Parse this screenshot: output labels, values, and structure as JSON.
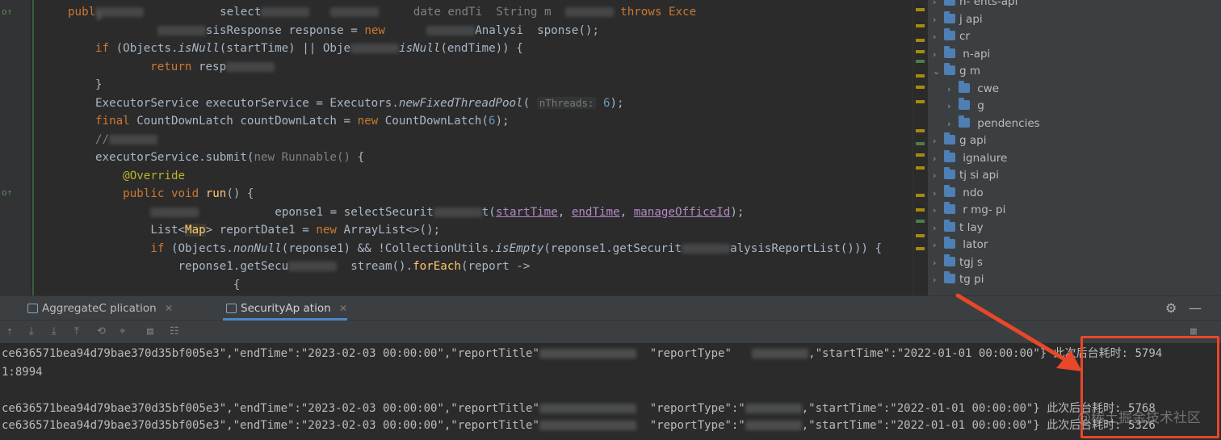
{
  "editor": {
    "lines": [
      {
        "segments": [
          {
            "t": "publ",
            "c": "kw"
          },
          {
            "t": "i",
            "c": "blur"
          },
          {
            "t": "           select",
            "c": ""
          },
          {
            "t": "",
            "c": "blur"
          },
          {
            "t": "   ",
            "c": ""
          },
          {
            "t": "",
            "c": "blur"
          },
          {
            "t": "     date endTi  String m  ",
            "c": "gray"
          },
          {
            "t": "",
            "c": "blur"
          },
          {
            "t": " throws Exce",
            "c": "kw"
          }
        ]
      },
      {
        "segments": [
          {
            "t": "         ",
            "c": ""
          },
          {
            "t": "",
            "c": "blur"
          },
          {
            "t": "sisResponse response = ",
            "c": ""
          },
          {
            "t": "new",
            "c": "kw"
          },
          {
            "t": "      ",
            "c": ""
          },
          {
            "t": "",
            "c": "blur"
          },
          {
            "t": "Analysi  sponse();",
            "c": ""
          }
        ]
      },
      {
        "segments": [
          {
            "t": "if",
            "c": "kw"
          },
          {
            "t": " (Objects.",
            "c": ""
          },
          {
            "t": "isNull",
            "c": "it"
          },
          {
            "t": "(startTime) || Obje",
            "c": ""
          },
          {
            "t": "",
            "c": "blur"
          },
          {
            "t": "isNull",
            "c": "it"
          },
          {
            "t": "(endTime)) {",
            "c": ""
          }
        ]
      },
      {
        "segments": [
          {
            "t": "    ",
            "c": ""
          },
          {
            "t": "return",
            "c": "kw"
          },
          {
            "t": " resp",
            "c": ""
          },
          {
            "t": "",
            "c": "blur"
          }
        ]
      },
      {
        "segments": [
          {
            "t": "}",
            "c": ""
          }
        ]
      },
      {
        "segments": [
          {
            "t": "ExecutorService executorService = Executors.",
            "c": ""
          },
          {
            "t": "newFixedThreadPool",
            "c": "it"
          },
          {
            "t": "( ",
            "c": ""
          },
          {
            "t": "nThreads:",
            "c": "hint"
          },
          {
            "t": " ",
            "c": ""
          },
          {
            "t": "6",
            "c": "num"
          },
          {
            "t": ");",
            "c": ""
          }
        ]
      },
      {
        "segments": [
          {
            "t": "final",
            "c": "kw"
          },
          {
            "t": " CountDownLatch countDownLatch = ",
            "c": ""
          },
          {
            "t": "new",
            "c": "kw"
          },
          {
            "t": " CountDownLatch(",
            "c": ""
          },
          {
            "t": "6",
            "c": "num"
          },
          {
            "t": ");",
            "c": ""
          }
        ]
      },
      {
        "segments": [
          {
            "t": "//",
            "c": "gray"
          },
          {
            "t": "",
            "c": "blur"
          }
        ]
      },
      {
        "segments": [
          {
            "t": "executorService.submit(",
            "c": ""
          },
          {
            "t": "new Runnable()",
            "c": "gray"
          },
          {
            "t": " {",
            "c": ""
          }
        ]
      },
      {
        "segments": [
          {
            "t": "    ",
            "c": ""
          },
          {
            "t": "@Override",
            "c": "ann"
          }
        ]
      },
      {
        "segments": [
          {
            "t": "    ",
            "c": ""
          },
          {
            "t": "public void",
            "c": "kw"
          },
          {
            "t": " ",
            "c": ""
          },
          {
            "t": "run",
            "c": "fn"
          },
          {
            "t": "() {",
            "c": ""
          }
        ]
      },
      {
        "segments": [
          {
            "t": "        ",
            "c": ""
          },
          {
            "t": "",
            "c": "blur"
          },
          {
            "t": "           eponse1 = selectSecurit",
            "c": ""
          },
          {
            "t": "",
            "c": "blur"
          },
          {
            "t": "t(",
            "c": ""
          },
          {
            "t": "startTime",
            "c": "param"
          },
          {
            "t": ", ",
            "c": ""
          },
          {
            "t": "endTime",
            "c": "param"
          },
          {
            "t": ", ",
            "c": ""
          },
          {
            "t": "manageOfficeId",
            "c": "param"
          },
          {
            "t": ");",
            "c": ""
          }
        ]
      },
      {
        "segments": [
          {
            "t": "        List<",
            "c": ""
          },
          {
            "t": "Map",
            "c": "type-hl"
          },
          {
            "t": "> reportDate1 = ",
            "c": ""
          },
          {
            "t": "new",
            "c": "kw"
          },
          {
            "t": " ArrayList<>();",
            "c": ""
          }
        ]
      },
      {
        "segments": [
          {
            "t": "        ",
            "c": ""
          },
          {
            "t": "if",
            "c": "kw"
          },
          {
            "t": " (Objects.",
            "c": ""
          },
          {
            "t": "nonNull",
            "c": "it"
          },
          {
            "t": "(reponse1) && !CollectionUtils.",
            "c": ""
          },
          {
            "t": "isEmpty",
            "c": "it"
          },
          {
            "t": "(reponse1.getSecurit",
            "c": ""
          },
          {
            "t": "",
            "c": "blur"
          },
          {
            "t": "alysisReportList())) {",
            "c": ""
          }
        ]
      },
      {
        "segments": [
          {
            "t": "            reponse1.getSecu",
            "c": ""
          },
          {
            "t": "",
            "c": "blur"
          },
          {
            "t": "  stream().",
            "c": ""
          },
          {
            "t": "forEach",
            "c": "fn"
          },
          {
            "t": "(report ->",
            "c": ""
          }
        ]
      },
      {
        "segments": [
          {
            "t": "                    {",
            "c": ""
          }
        ]
      }
    ]
  },
  "tree": {
    "items": [
      {
        "label": "n-         ents-api",
        "expanded": false,
        "indent": 0
      },
      {
        "label": "j      api",
        "expanded": false,
        "indent": 0
      },
      {
        "label": "cr",
        "expanded": false,
        "indent": 0
      },
      {
        "label": "      n-api",
        "expanded": false,
        "indent": 0
      },
      {
        "label": "g     m",
        "expanded": true,
        "indent": 0
      },
      {
        "label": "     cwe",
        "expanded": false,
        "indent": 1
      },
      {
        "label": "      g",
        "expanded": false,
        "indent": 1
      },
      {
        "label": "      pendencies",
        "expanded": false,
        "indent": 1
      },
      {
        "label": "g    api",
        "expanded": false,
        "indent": 0
      },
      {
        "label": "         ignalure",
        "expanded": false,
        "indent": 0
      },
      {
        "label": "tj            si       api",
        "expanded": false,
        "indent": 0
      },
      {
        "label": "         ndo",
        "expanded": false,
        "indent": 0
      },
      {
        "label": "      r    mg- pi",
        "expanded": false,
        "indent": 0
      },
      {
        "label": "t      lay",
        "expanded": false,
        "indent": 0
      },
      {
        "label": "         lator",
        "expanded": false,
        "indent": 0
      },
      {
        "label": "tgj      s",
        "expanded": false,
        "indent": 0
      },
      {
        "label": "tg         pi",
        "expanded": false,
        "indent": 0
      }
    ]
  },
  "run": {
    "tabs": [
      {
        "label": "AggregateC        plication",
        "active": false
      },
      {
        "label": "SecurityAp     ation",
        "active": true
      }
    ],
    "lines": [
      {
        "text": "ce636571bea94d79bae370d35bf005e3\",\"endTime\":\"2023-02-03 00:00:00\",\"reportTitle\"",
        "mid": "  \"reportType\"   ",
        "tail": ",\"startTime\":\"2022-01-01 00:00:00\"}",
        "timing": " 此次后台耗时: 5794"
      },
      {
        "text": "1:8994",
        "mid": "",
        "tail": "",
        "timing": ""
      },
      {
        "text": "",
        "mid": "",
        "tail": "",
        "timing": ""
      },
      {
        "text": "ce636571bea94d79bae370d35bf005e3\",\"endTime\":\"2023-02-03 00:00:00\",\"reportTitle\"",
        "mid": "  \"reportType\":\"",
        "tail": ",\"startTime\":\"2022-01-01 00:00:00\"}",
        "timing": " 此次后台耗时: 5768"
      },
      {
        "text": "ce636571bea94d79bae370d35bf005e3\",\"endTime\":\"2023-02-03 00:00:00\",\"reportTitle\"",
        "mid": "  \"reportType\":\"",
        "tail": ",\"startTime\":\"2022-01-01 00:00:00\"}",
        "timing": " 此次后台耗时: 5326"
      }
    ]
  },
  "watermark": "@稀土掘金技术社区",
  "colors": {
    "highlight_box": "#e8472a",
    "background": "#2b2b2b"
  }
}
